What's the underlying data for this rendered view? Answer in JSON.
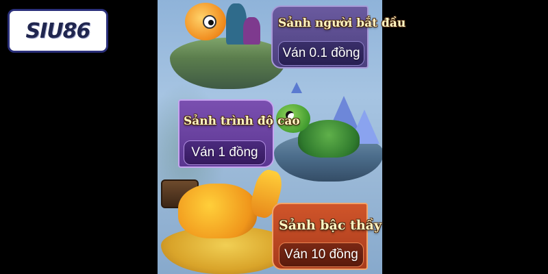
{
  "brand": {
    "logo_text": "SIU86"
  },
  "lobbies": [
    {
      "title": "Sảnh người bắt đầu",
      "stake": "Ván 0.1 đồng",
      "mascot": "goldfish"
    },
    {
      "title": "Sảnh trình độ cao",
      "stake": "Ván 1 đồng",
      "mascot": "turtle"
    },
    {
      "title": "Sảnh bậc thầy",
      "stake": "Ván 10 đồng",
      "mascot": "crocodile"
    }
  ],
  "colors": {
    "lobby_beginner": "#4b3f7e",
    "lobby_advanced": "#5a3690",
    "lobby_master": "#a83a1c",
    "title_text": "#fff4c2"
  }
}
